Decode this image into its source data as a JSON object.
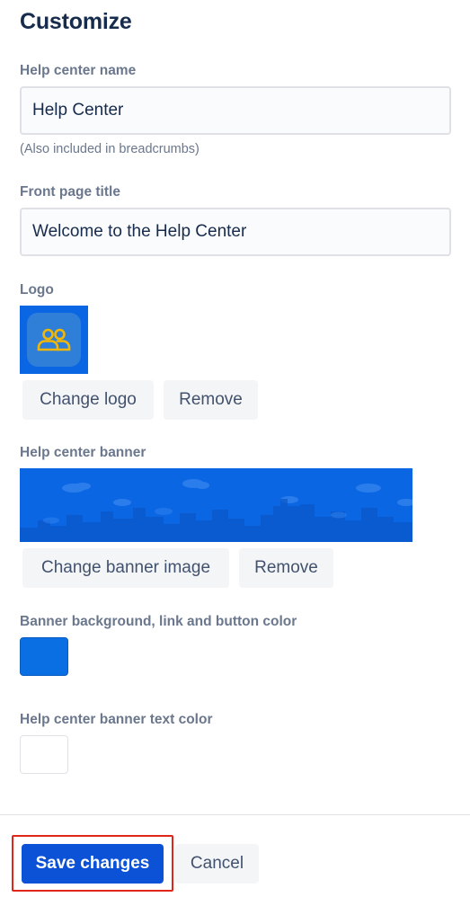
{
  "header": {
    "title": "Customize"
  },
  "help_center_name": {
    "label": "Help center name",
    "value": "Help Center",
    "helper": "(Also included in breadcrumbs)"
  },
  "front_page_title": {
    "label": "Front page title",
    "value": "Welcome to the Help Center"
  },
  "logo": {
    "label": "Logo",
    "icon": "people-group-icon",
    "icon_color": "#f2b705",
    "change_label": "Change logo",
    "remove_label": "Remove"
  },
  "banner": {
    "label": "Help center banner",
    "change_label": "Change banner image",
    "remove_label": "Remove"
  },
  "banner_color": {
    "label": "Banner background, link and button color",
    "value": "#0b6fe4"
  },
  "banner_text_color": {
    "label": "Help center banner text color",
    "value": "#ffffff"
  },
  "footer": {
    "save_label": "Save changes",
    "cancel_label": "Cancel"
  }
}
